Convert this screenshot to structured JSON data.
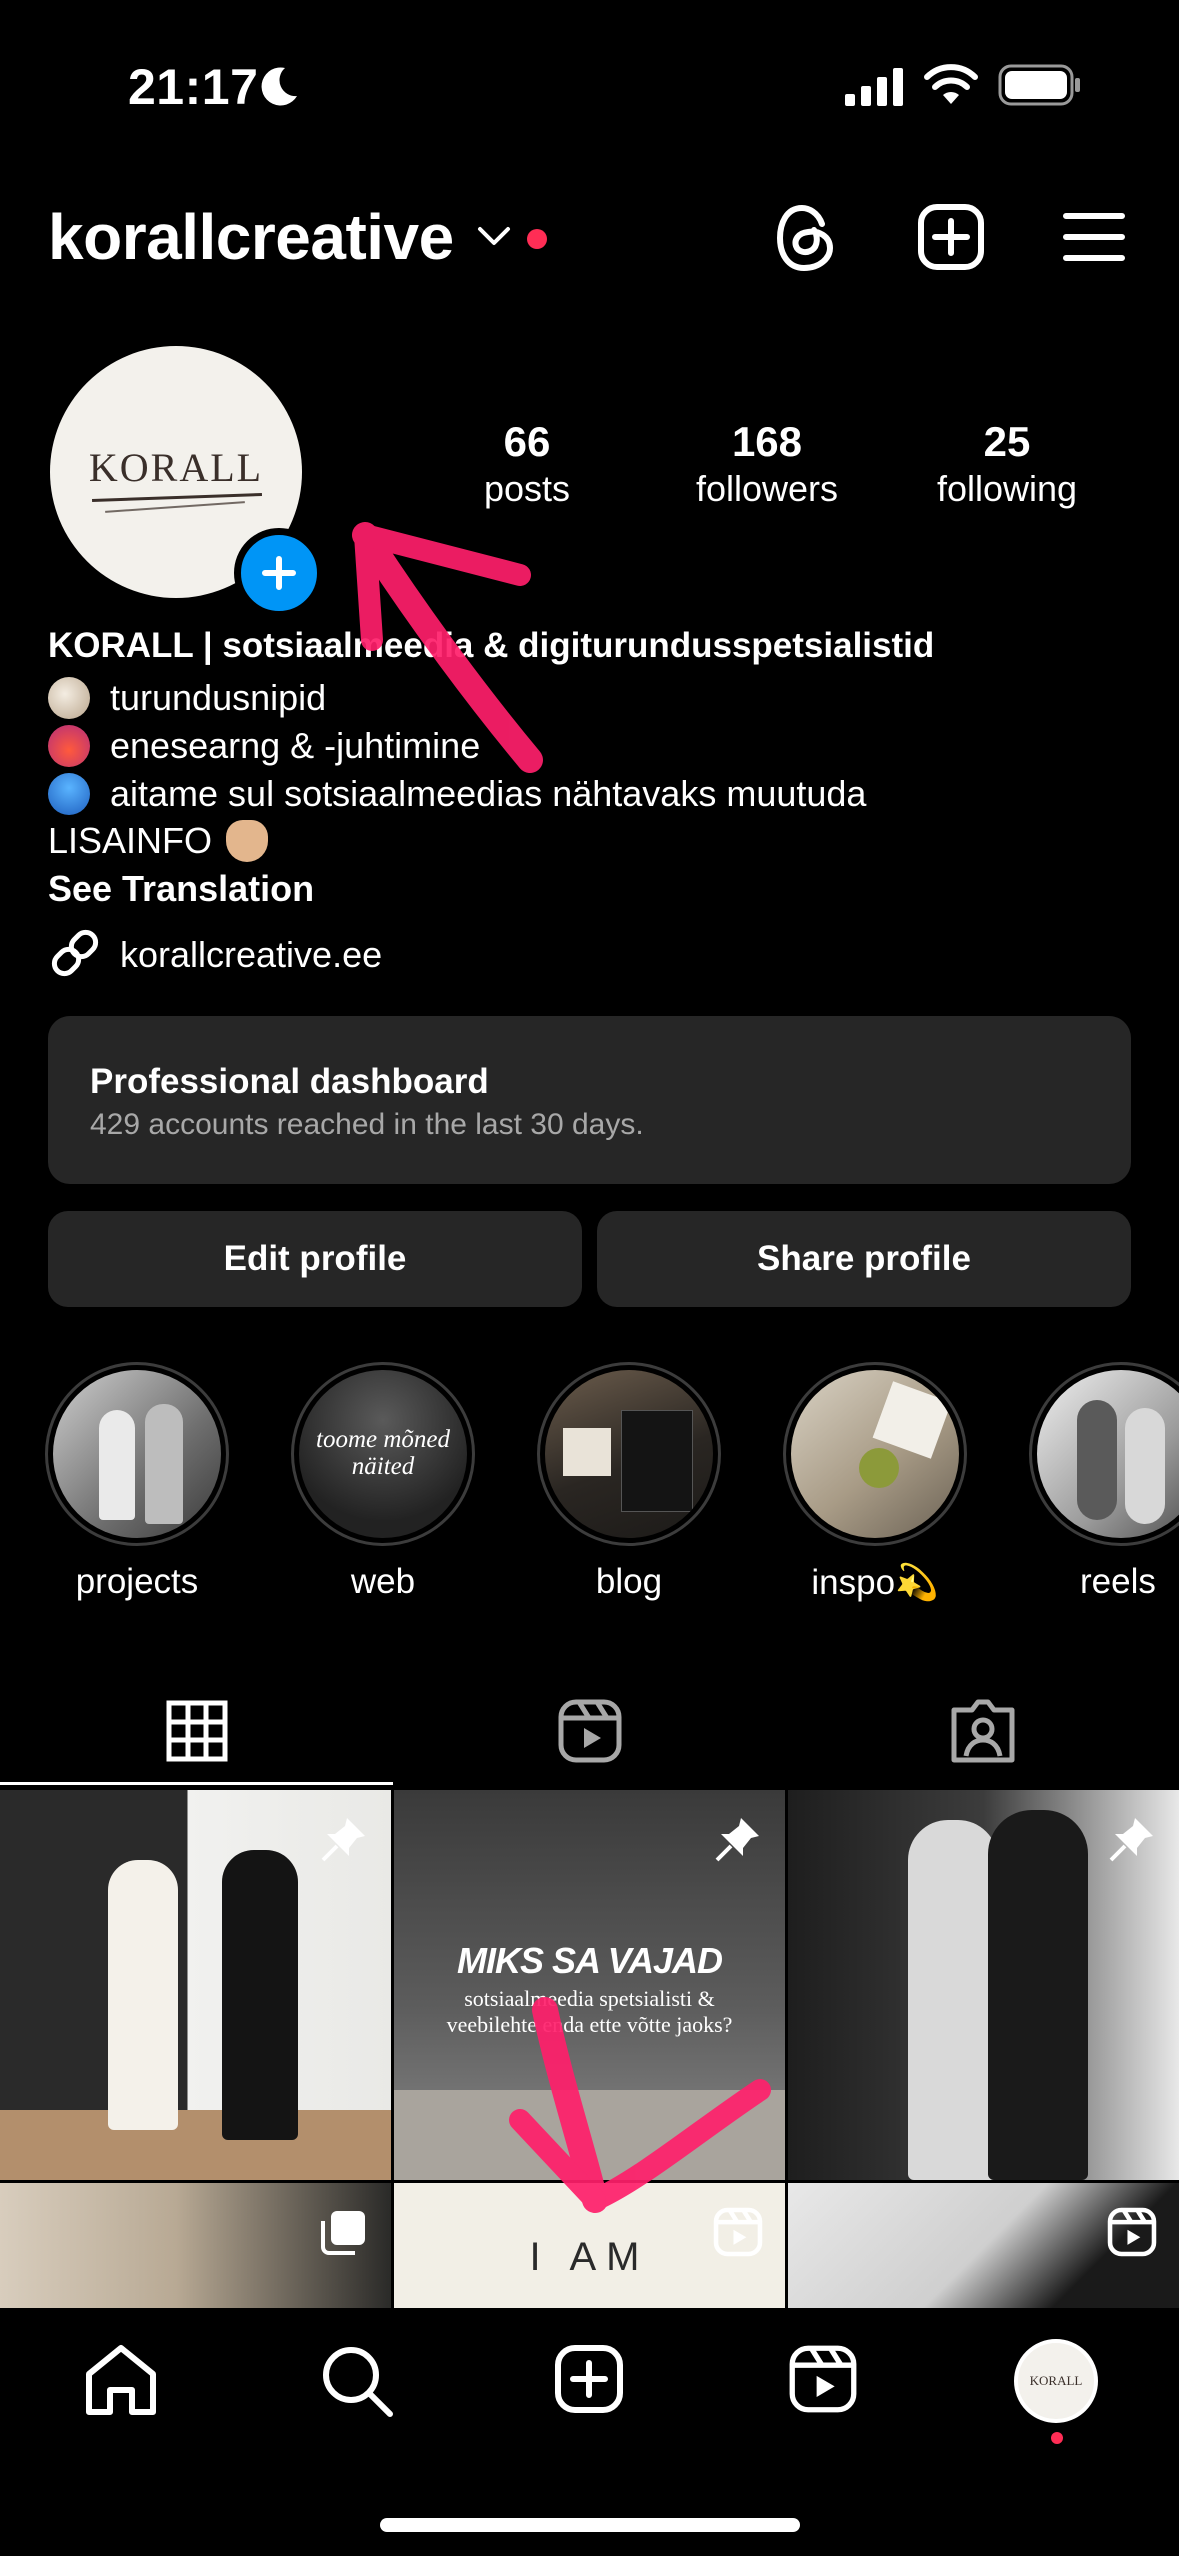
{
  "status_bar": {
    "time": "21:17"
  },
  "header": {
    "username": "korallcreative"
  },
  "avatar": {
    "text": "KORALL"
  },
  "stats": [
    {
      "value": "66",
      "label": "posts"
    },
    {
      "value": "168",
      "label": "followers"
    },
    {
      "value": "25",
      "label": "following"
    }
  ],
  "bio": {
    "name": "KORALL | sotsiaalmeedia & digiturundusspetsialistid",
    "lines": [
      {
        "icon": "shell-icon",
        "text": "turundusnipid"
      },
      {
        "icon": "coral-icon",
        "text": "enesearng & -juhtimine"
      },
      {
        "icon": "jellyfish-icon",
        "text": "aitame sul sotsiaalmeedias nähtavaks muutuda"
      }
    ],
    "lisainfo": "LISAINFO",
    "see_translation": "See Translation",
    "link": "korallcreative.ee"
  },
  "dashboard": {
    "title": "Professional dashboard",
    "subtitle": "429 accounts reached in the last 30 days."
  },
  "buttons": {
    "edit": "Edit profile",
    "share": "Share profile"
  },
  "highlights": [
    {
      "label": "projects"
    },
    {
      "label": "web",
      "cover_text": "toome mõned näited"
    },
    {
      "label": "blog"
    },
    {
      "label": "inspo💫"
    },
    {
      "label": "reels"
    }
  ],
  "grid": {
    "post2_title": "MIKS SA VAJAD",
    "post2_sub": "sotsiaalmeedia spetsialisti & veebilehte enda ette võtte jaoks?",
    "post5_text": "I AM"
  },
  "colors": {
    "accent": "#0095f6",
    "notification": "#ff2d55",
    "annotation": "#ff1f6b",
    "card": "#262626"
  }
}
